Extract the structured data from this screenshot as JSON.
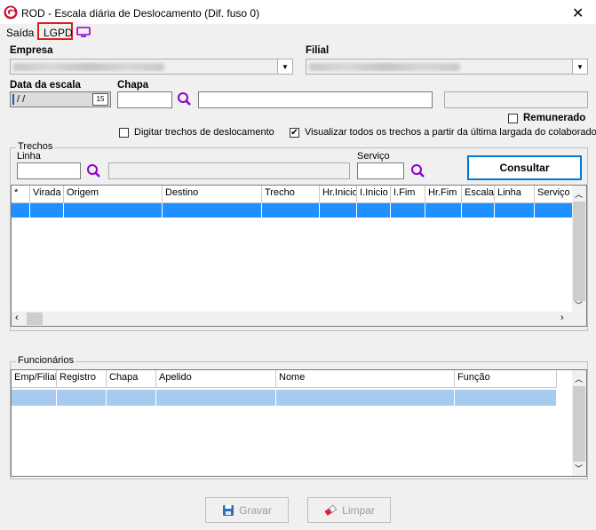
{
  "window": {
    "title": "ROD - Escala diária de Deslocamento (Dif. fuso 0)"
  },
  "menu": {
    "exit_label": "Saída",
    "lgpd_label": "LGPD"
  },
  "empresa": {
    "label": "Empresa"
  },
  "filial": {
    "label": "Filial"
  },
  "data_escala": {
    "label": "Data da escala",
    "value": " / /",
    "calendar_label": "15"
  },
  "chapa": {
    "label": "Chapa"
  },
  "remunerado": {
    "label": "Remunerado",
    "checked": false
  },
  "digitar_trechos": {
    "label": "Digitar trechos de deslocamento",
    "checked": false
  },
  "visualizar_trechos": {
    "label": "Visualizar todos os trechos a partir da última largada do colaborador",
    "checked": true,
    "mark": "✔"
  },
  "trechos": {
    "title": "Trechos",
    "linha_label": "Linha",
    "servico_label": "Serviço",
    "consultar_label": "Consultar",
    "columns": [
      "*",
      "Virada",
      "Origem",
      "Destino",
      "Trecho",
      "Hr.Inicio",
      "I.Inicio",
      "I.Fim",
      "Hr.Fim",
      "Escala",
      "Linha",
      "Serviço"
    ]
  },
  "funcionarios": {
    "title": "Funcionários",
    "columns": [
      "Emp/Filial",
      "Registro",
      "Chapa",
      "Apelido",
      "Nome",
      "Função"
    ]
  },
  "actions": {
    "save_label": "Gravar",
    "clear_label": "Limpar"
  },
  "colors": {
    "selection": "#1e90ff",
    "funcionarios_selection": "#a6caf0",
    "accent_purple": "#8b00c8",
    "lgpd_border": "#e02020"
  }
}
